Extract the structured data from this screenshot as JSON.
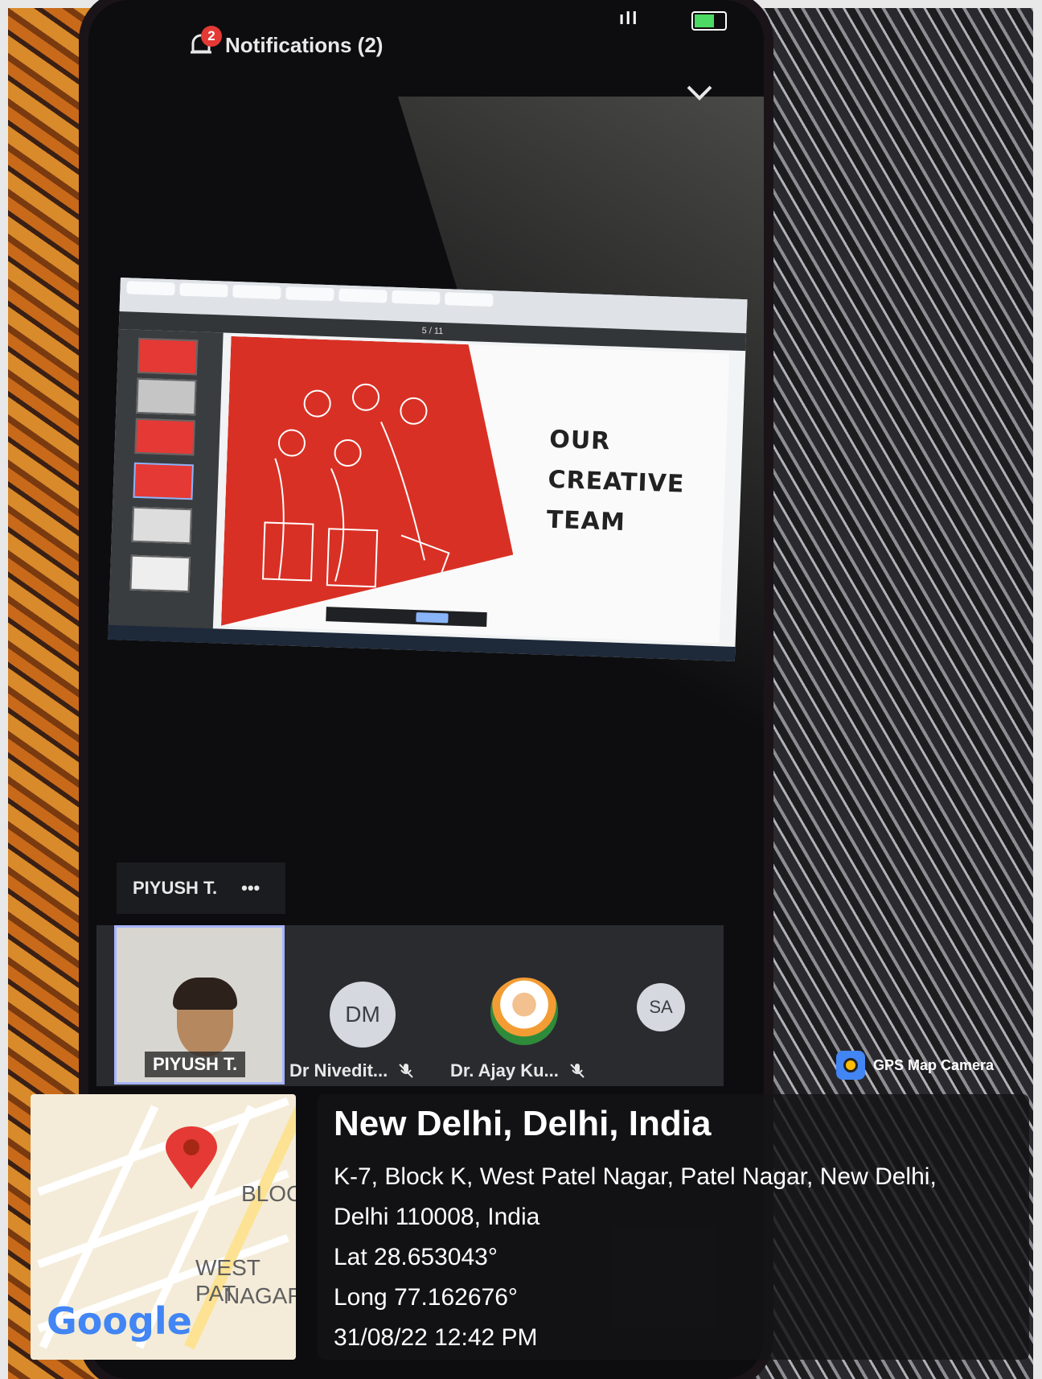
{
  "status_bar": {
    "signal": "ıll"
  },
  "notifications": {
    "label": "Notifications (2)",
    "badge": "2"
  },
  "shared_screen": {
    "slide_title_lines": [
      "OUR",
      "CREATIVE",
      "TEAM"
    ],
    "viewer_page": "5 / 11"
  },
  "pinned": {
    "name": "PIYUSH T.",
    "more": "•••"
  },
  "participants": [
    {
      "name": "PIYUSH T.",
      "initials": "",
      "muted": false
    },
    {
      "name": "Dr Nivedit...",
      "initials": "DM",
      "muted": true
    },
    {
      "name": "Dr. Ajay Ku...",
      "initials": "",
      "muted": true
    },
    {
      "name": "",
      "initials": "SA",
      "muted": false
    }
  ],
  "gps": {
    "brand": "GPS Map Camera",
    "city": "New Delhi, Delhi, India",
    "address_line1": "K-7, Block K, West Patel Nagar, Patel Nagar, New Delhi,",
    "address_line2": "Delhi 110008, India",
    "lat": "Lat 28.653043°",
    "long": "Long 77.162676°",
    "datetime": "31/08/22 12:42 PM"
  },
  "map": {
    "label_block": "BLOC",
    "label_west1": "WEST PAT",
    "label_west2": "NAGAR",
    "brand": "Google"
  },
  "colors": {
    "accent": "#d93025",
    "badge": "#e53935",
    "self_border": "#a7b5ff"
  }
}
